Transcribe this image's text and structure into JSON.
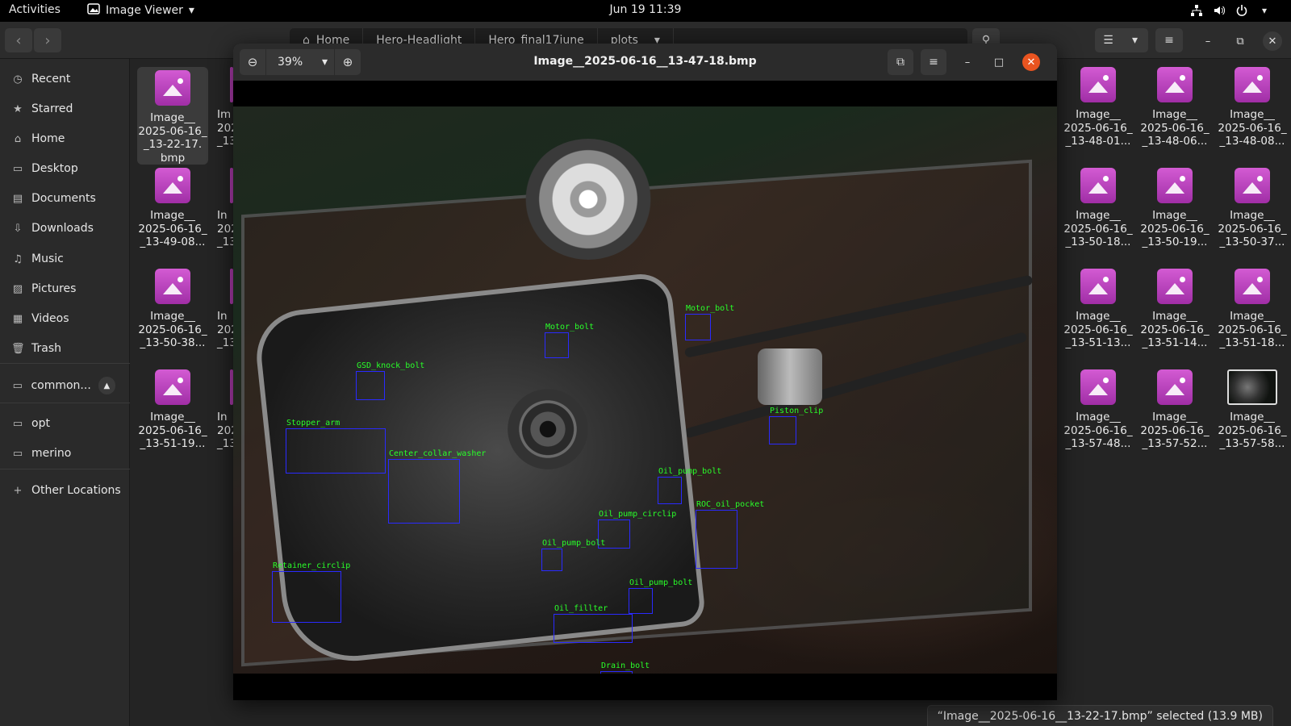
{
  "topbar": {
    "activities": "Activities",
    "app_name": "Image Viewer",
    "clock": "Jun 19  11:39",
    "tray_icons": [
      "network-icon",
      "volume-icon",
      "power-icon"
    ]
  },
  "files": {
    "breadcrumbs": [
      "Home",
      "Hero-Headlight",
      "Hero_final17june",
      "plots"
    ],
    "sidebar": [
      {
        "label": "Recent",
        "icon": "clock-icon"
      },
      {
        "label": "Starred",
        "icon": "star-icon"
      },
      {
        "label": "Home",
        "icon": "home-icon"
      },
      {
        "label": "Desktop",
        "icon": "desktop-icon"
      },
      {
        "label": "Documents",
        "icon": "document-icon"
      },
      {
        "label": "Downloads",
        "icon": "download-icon"
      },
      {
        "label": "Music",
        "icon": "music-icon"
      },
      {
        "label": "Pictures",
        "icon": "picture-icon"
      },
      {
        "label": "Videos",
        "icon": "video-icon"
      },
      {
        "label": "Trash",
        "icon": "trash-icon"
      },
      {
        "label": "common...",
        "icon": "drive-icon"
      },
      {
        "label": "opt",
        "icon": "folder-icon"
      },
      {
        "label": "merino",
        "icon": "folder-icon"
      },
      {
        "label": "Other Locations",
        "icon": "plus-icon"
      }
    ],
    "left_files": [
      {
        "lines": [
          "Image__",
          "2025-06-16_",
          "_13-22-17.",
          "bmp"
        ],
        "selected": true
      },
      {
        "lines": [
          "Image__",
          "2025-06-16_",
          "_13-49-08..."
        ],
        "selected": false
      },
      {
        "lines": [
          "Image__",
          "2025-06-16_",
          "_13-50-38..."
        ],
        "selected": false
      },
      {
        "lines": [
          "Image__",
          "2025-06-16_",
          "_13-51-19..."
        ],
        "selected": false
      }
    ],
    "partial_column": [
      "Im",
      "202",
      "_13",
      "In",
      "202",
      "_13",
      "In",
      "202",
      "_13",
      "In",
      "202",
      "_13"
    ],
    "right_files": [
      [
        {
          "lines": [
            "Image__",
            "2025-06-16_",
            "_13-48-01..."
          ]
        },
        {
          "lines": [
            "Image__",
            "2025-06-16_",
            "_13-48-06..."
          ]
        },
        {
          "lines": [
            "Image__",
            "2025-06-16_",
            "_13-48-08..."
          ]
        }
      ],
      [
        {
          "lines": [
            "Image__",
            "2025-06-16_",
            "_13-50-18..."
          ]
        },
        {
          "lines": [
            "Image__",
            "2025-06-16_",
            "_13-50-19..."
          ]
        },
        {
          "lines": [
            "Image__",
            "2025-06-16_",
            "_13-50-37..."
          ]
        }
      ],
      [
        {
          "lines": [
            "Image__",
            "2025-06-16_",
            "_13-51-13..."
          ]
        },
        {
          "lines": [
            "Image__",
            "2025-06-16_",
            "_13-51-14..."
          ]
        },
        {
          "lines": [
            "Image__",
            "2025-06-16_",
            "_13-51-18..."
          ]
        }
      ],
      [
        {
          "lines": [
            "Image__",
            "2025-06-16_",
            "_13-57-48..."
          ]
        },
        {
          "lines": [
            "Image__",
            "2025-06-16_",
            "_13-57-52..."
          ]
        },
        {
          "lines": [
            "Image__",
            "2025-06-16_",
            "_13-57-58..."
          ],
          "photo": true
        }
      ]
    ],
    "status": "“Image__2025-06-16__13-22-17.bmp” selected  (13.9 MB)"
  },
  "viewer": {
    "title": "Image__2025-06-16__13-47-18.bmp",
    "zoom": "39%",
    "detections": [
      {
        "label": "Motor_bolt"
      },
      {
        "label": "Motor_bolt"
      },
      {
        "label": "GSD_knock_bolt"
      },
      {
        "label": "Stopper_arm"
      },
      {
        "label": "Center_collar_washer"
      },
      {
        "label": "Piston_clip"
      },
      {
        "label": "Oil_pump_bolt"
      },
      {
        "label": "Oil_pump_circlip"
      },
      {
        "label": "ROC_oil_pocket"
      },
      {
        "label": "Oil_pump_bolt"
      },
      {
        "label": "Retainer_circlip"
      },
      {
        "label": "Oil_pump_bolt"
      },
      {
        "label": "Oil_fillter"
      },
      {
        "label": "Drain_bolt"
      }
    ]
  }
}
